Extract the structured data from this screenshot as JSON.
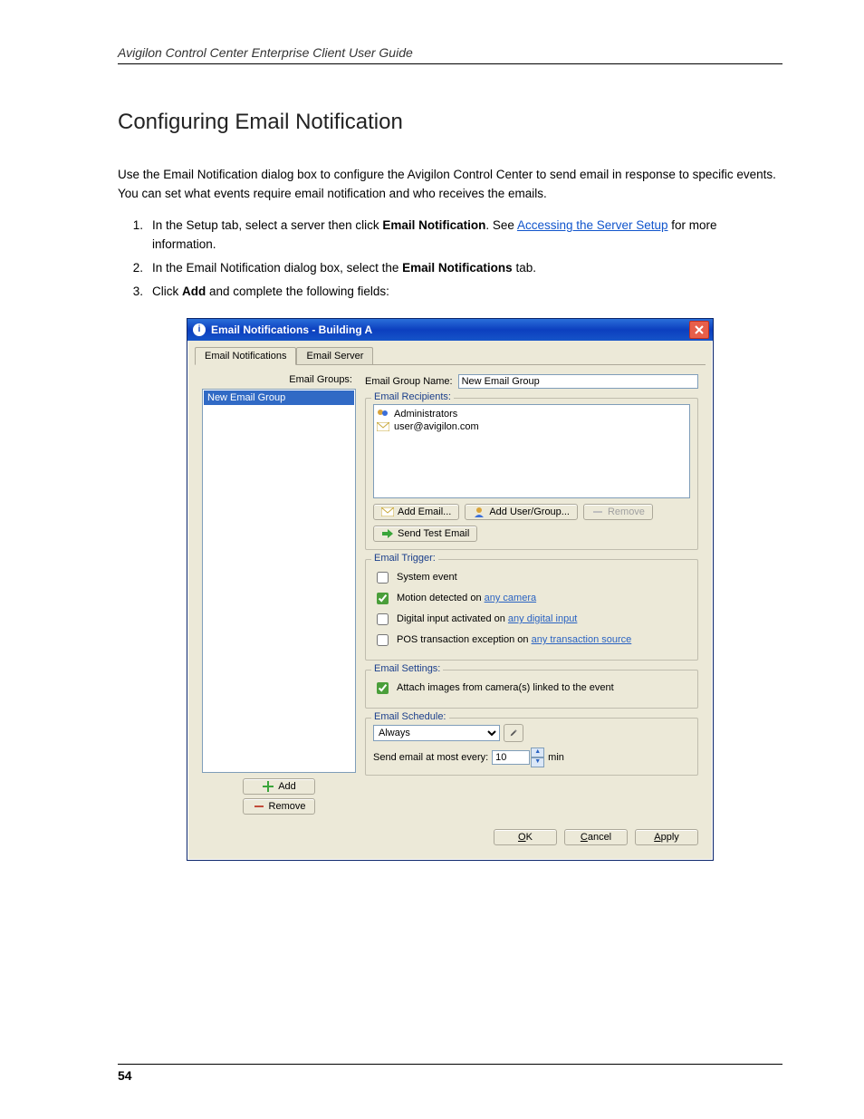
{
  "doc": {
    "header": "Avigilon Control Center Enterprise Client User Guide",
    "section_title": "Configuring Email Notification",
    "para1": "Use the Email Notification dialog box to configure the Avigilon Control Center to send email in response to specific events. You can set what events require email notification and who receives the emails.",
    "intro_steps_lead": "1.",
    "step1_a": "In the Setup tab, select a server then click ",
    "step1_b": "Email Notification",
    "step1_c": ". See ",
    "step1_link": "Accessing the Server Setup",
    "step1_d": " for more information.",
    "step2_a": "In the Email Notification dialog box, select the ",
    "step2_b": "Email Notifications",
    "step2_c": " tab.",
    "step3_a": "Click ",
    "step3_b": "Add",
    "step3_c": " and complete the following fields:",
    "page_number": "54"
  },
  "dialog": {
    "title": "Email Notifications - Building A",
    "tabs": [
      "Email Notifications",
      "Email Server"
    ],
    "left": {
      "label": "Email Groups:",
      "items": [
        "New Email Group"
      ],
      "add": "Add",
      "remove": "Remove"
    },
    "right": {
      "group_name_label": "Email Group Name:",
      "group_name_value": "New Email Group",
      "recipients_legend": "Email Recipients:",
      "recipients": [
        "Administrators",
        "user@avigilon.com"
      ],
      "btn_add_email": "Add Email...",
      "btn_add_usergroup": "Add User/Group...",
      "btn_remove": "Remove",
      "btn_send_test": "Send Test Email",
      "trigger_legend": "Email Trigger:",
      "trig_system": "System event",
      "trig_motion_a": "Motion detected on ",
      "trig_motion_link": "any camera",
      "trig_digital_a": "Digital input activated on ",
      "trig_digital_link": "any digital input",
      "trig_pos_a": "POS transaction exception on ",
      "trig_pos_link": "any transaction source",
      "settings_legend": "Email Settings:",
      "attach_images": "Attach images from camera(s) linked to the event",
      "schedule_legend": "Email Schedule:",
      "schedule_value": "Always",
      "interval_label": "Send email at most every:",
      "interval_value": "10",
      "interval_unit": "min"
    },
    "footer": {
      "ok": "OK",
      "cancel": "Cancel",
      "apply": "Apply"
    }
  }
}
